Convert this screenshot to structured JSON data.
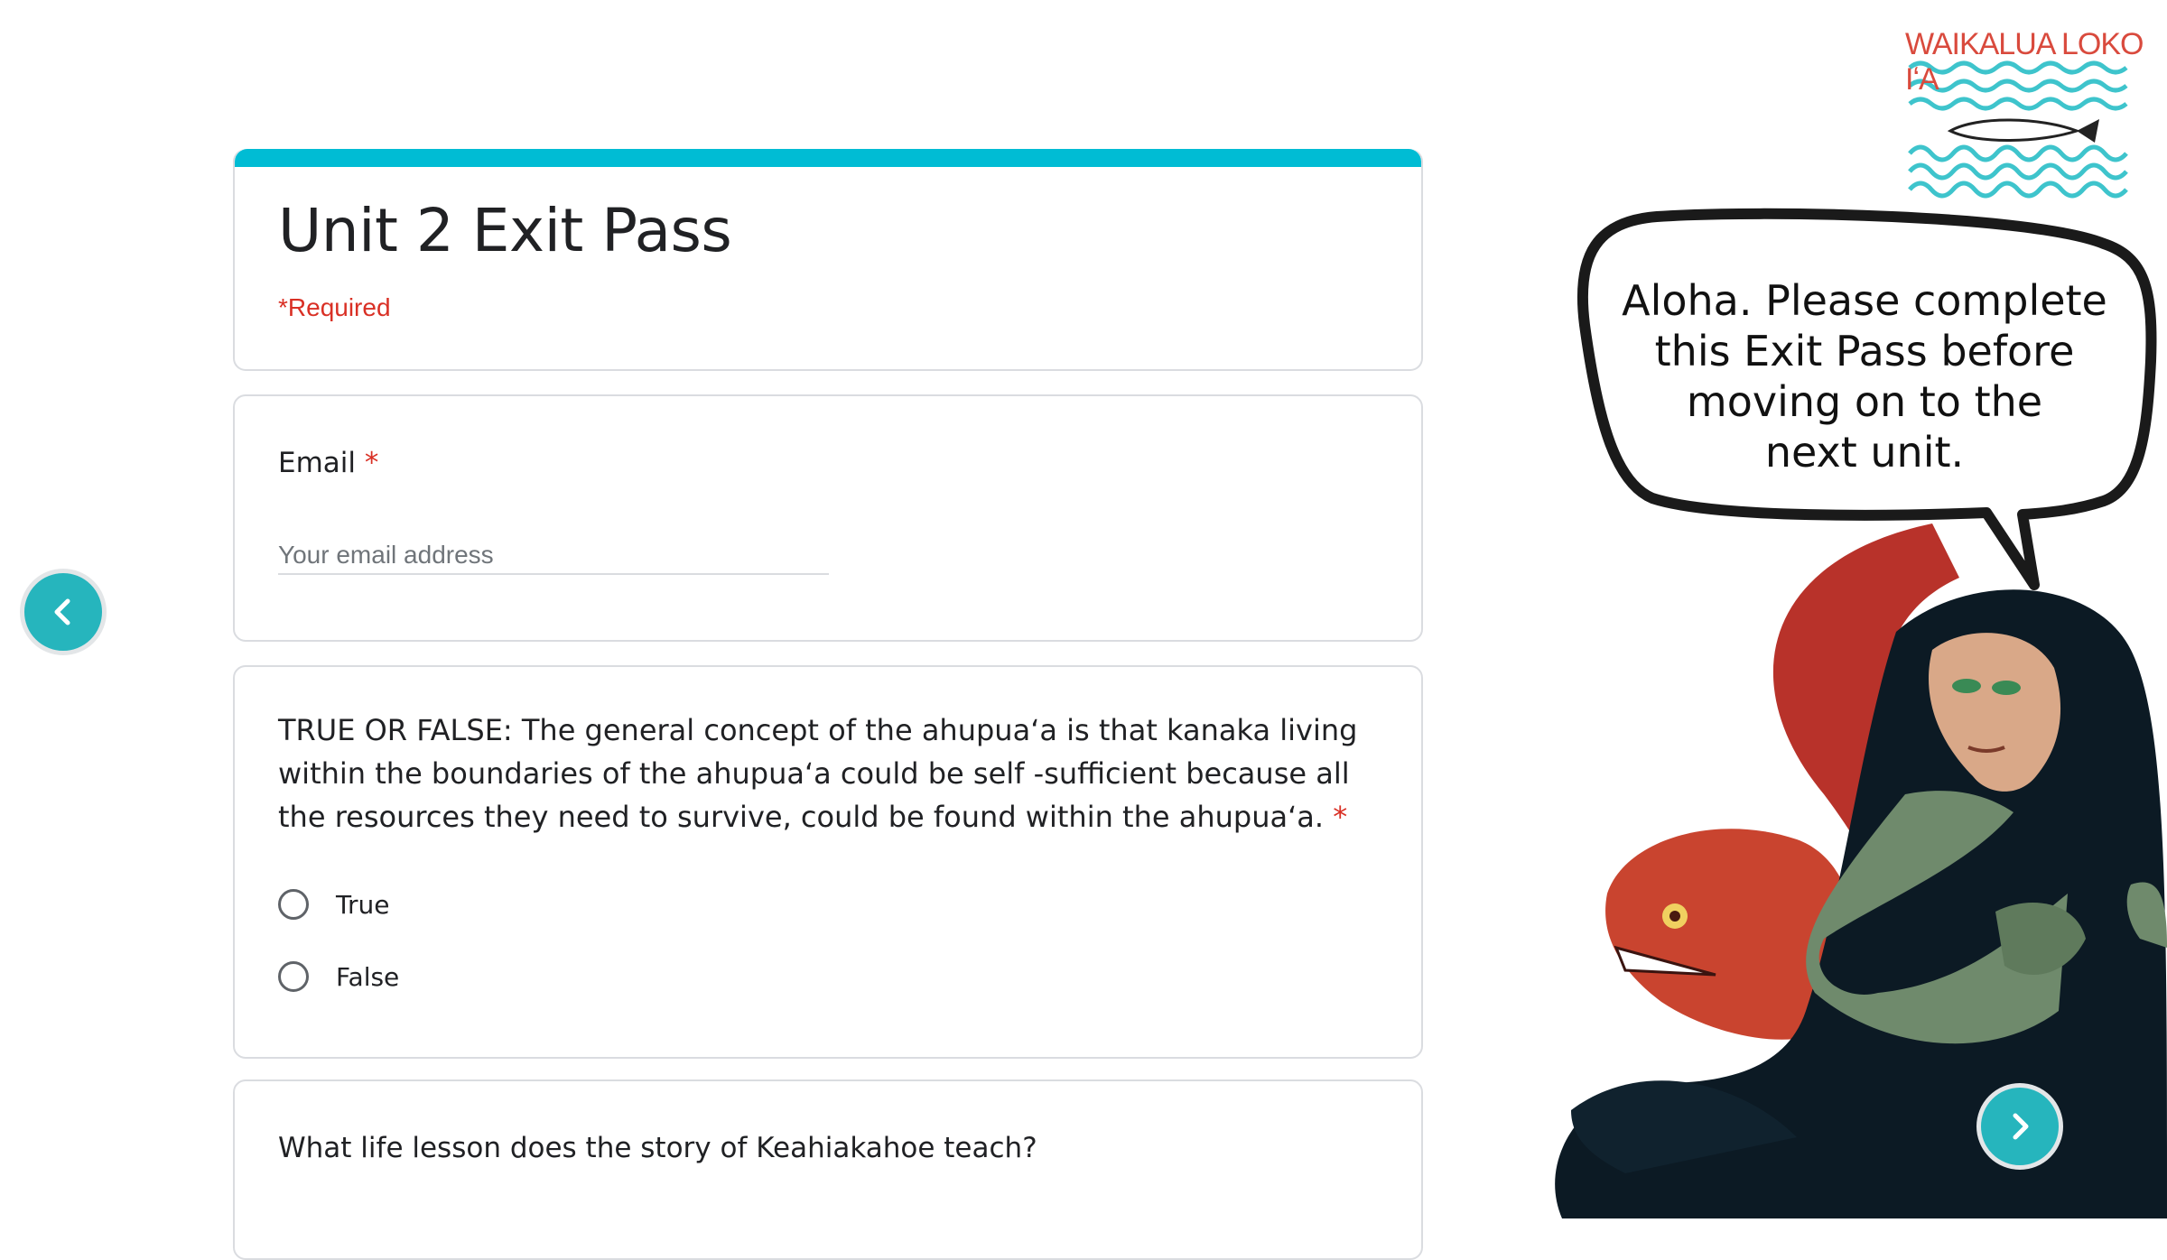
{
  "form": {
    "title": "Unit 2 Exit Pass",
    "required_note": "*Required",
    "accent_color": "#00bcd4",
    "required_color": "#d93025"
  },
  "email_question": {
    "label": "Email",
    "required_marker": "*",
    "placeholder": "Your email address"
  },
  "tf_question": {
    "text": "TRUE OR FALSE: The general concept of the ahupuaʻa is that kanaka living within the boundaries of the ahupuaʻa could be self -sufficient because all the resources they need to survive, could be found within the ahupuaʻa.",
    "required_marker": "*",
    "options": [
      "True",
      "False"
    ]
  },
  "life_question": {
    "text": "What life lesson does the story of Keahiakahoe teach?"
  },
  "speech_bubble": {
    "lines": [
      "Aloha. Please complete",
      "this Exit Pass before",
      "moving on to the",
      "next unit."
    ]
  },
  "logo": {
    "text": "WAIKALUA LOKO IʻA"
  },
  "navigation": {
    "prev_icon": "chevron-left-icon",
    "next_icon": "chevron-right-icon",
    "button_color": "#26b5bd"
  }
}
